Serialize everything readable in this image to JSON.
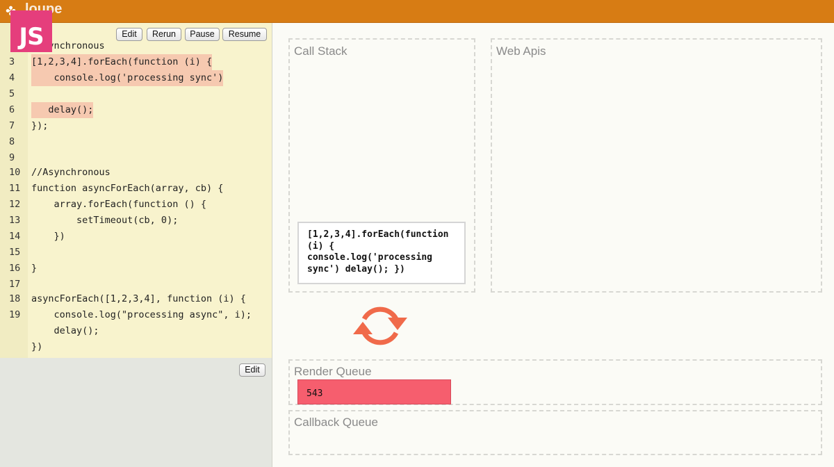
{
  "app": {
    "title": "loupe"
  },
  "logo": {
    "text": "JS"
  },
  "toolbar": {
    "edit": "Edit",
    "rerun": "Rerun",
    "pause": "Pause",
    "resume": "Resume"
  },
  "editor": {
    "lines": [
      {
        "num": "",
        "text": "//Synchronous"
      },
      {
        "num": "3",
        "text": "[1,2,3,4].forEach(function (i) {"
      },
      {
        "num": "4",
        "text": "    console.log('processing sync')"
      },
      {
        "num": "5",
        "text": ""
      },
      {
        "num": "6",
        "text": "   delay();"
      },
      {
        "num": "7",
        "text": "});"
      },
      {
        "num": "8",
        "text": ""
      },
      {
        "num": "9",
        "text": ""
      },
      {
        "num": "10",
        "text": "//Asynchronous"
      },
      {
        "num": "11",
        "text": "function asyncForEach(array, cb) {"
      },
      {
        "num": "12",
        "text": "    array.forEach(function () {"
      },
      {
        "num": "13",
        "text": "        setTimeout(cb, 0);"
      },
      {
        "num": "14",
        "text": "    })"
      },
      {
        "num": "15",
        "text": ""
      },
      {
        "num": "16",
        "text": "}"
      },
      {
        "num": "17",
        "text": ""
      },
      {
        "num": "18",
        "text": "asyncForEach([1,2,3,4], function (i) {"
      },
      {
        "num": "19",
        "text": "    console.log(\"processing async\", i);"
      },
      {
        "num": "",
        "text": "    delay();"
      },
      {
        "num": "",
        "text": "})"
      }
    ]
  },
  "html_panel": {
    "edit": "Edit"
  },
  "call_stack": {
    "title": "Call Stack",
    "frame": "[1,2,3,4].forEach(function (i) { console.log('processing sync') delay(); })"
  },
  "web_apis": {
    "title": "Web Apis"
  },
  "render_queue": {
    "title": "Render Queue",
    "item": "543"
  },
  "callback_queue": {
    "title": "Callback Queue"
  },
  "colors": {
    "topbar": "#d77c14",
    "logo": "#e53e7c",
    "highlight": "#f6c9b0",
    "render_item": "#f65e6e",
    "loop_icon": "#f06a4a"
  }
}
